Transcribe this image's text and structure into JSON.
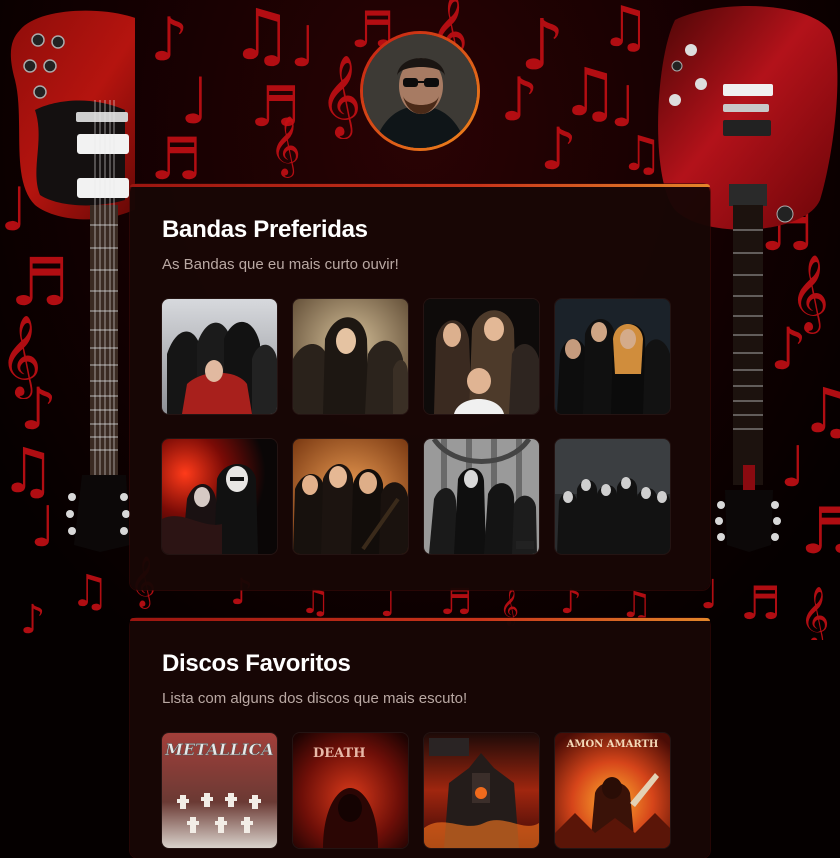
{
  "profile": {
    "avatar_icon": "profile-photo"
  },
  "bands_section": {
    "title": "Bandas Preferidas",
    "subtitle": "As Bandas que eu mais curto ouvir!",
    "items": [
      {
        "icon": "band-photo-1"
      },
      {
        "icon": "band-photo-2"
      },
      {
        "icon": "band-photo-3"
      },
      {
        "icon": "band-photo-4"
      },
      {
        "icon": "band-photo-5"
      },
      {
        "icon": "band-photo-6"
      },
      {
        "icon": "band-photo-7"
      },
      {
        "icon": "band-photo-8"
      }
    ]
  },
  "discs_section": {
    "title": "Discos Favoritos",
    "subtitle": "Lista com alguns dos discos que mais escuto!",
    "items": [
      {
        "icon": "album-cover-1",
        "logo_text": "METALLICA"
      },
      {
        "icon": "album-cover-2",
        "logo_text": "DEATH"
      },
      {
        "icon": "album-cover-3",
        "logo_text": ""
      },
      {
        "icon": "album-cover-4",
        "logo_text": "AMON AMARTH"
      }
    ]
  },
  "colors": {
    "accent_start": "#9c1510",
    "accent_end": "#e3862a",
    "card_bg": "#180605",
    "note_red": "#c30f14"
  }
}
